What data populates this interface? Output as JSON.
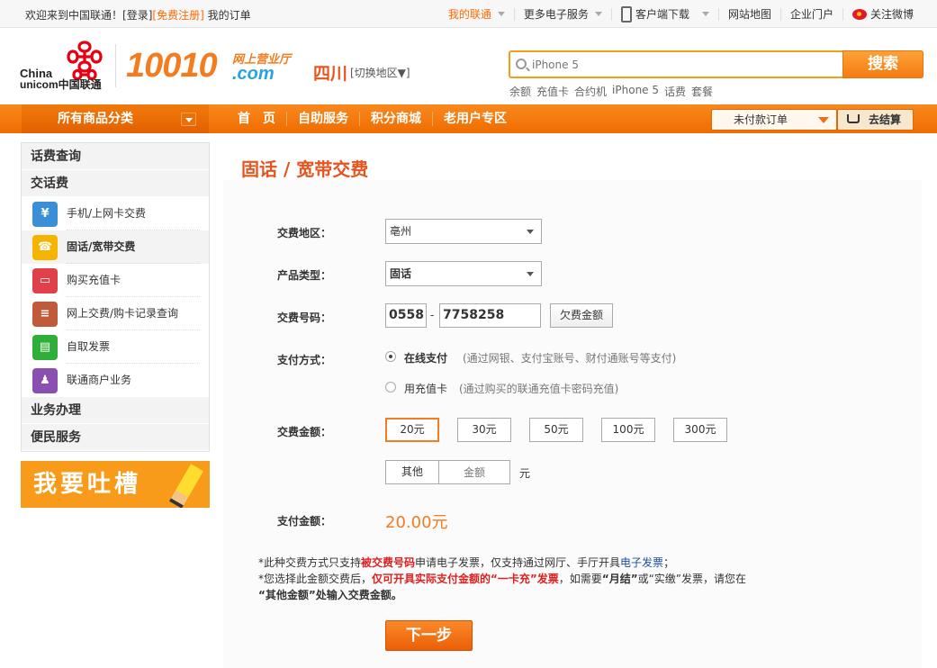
{
  "topbar": {
    "welcome": "欢迎来到中国联通！",
    "login": "[登录]",
    "register": "[免费注册]",
    "my_orders": "我的订单",
    "my_unicom": "我的联通",
    "more_services": "更多电子服务",
    "client_download": "客户端下载",
    "sitemap": "网站地图",
    "enterprise": "企业门户",
    "weibo": "关注微博"
  },
  "header": {
    "logo_cn": "China",
    "logo_unicom": "unicom中国联通",
    "logo_number": "10010",
    "logo_hall": "网上营业厅",
    "logo_com": ".com",
    "province": "四川",
    "switch_area": "[切换地区▼]",
    "search_placeholder": "iPhone 5",
    "search_button": "搜索",
    "hotwords": [
      "余额",
      "充值卡",
      "合约机",
      "iPhone 5",
      "话费",
      "套餐"
    ]
  },
  "nav": {
    "all_categories": "所有商品分类",
    "links": [
      "首　页",
      "自助服务",
      "积分商城",
      "老用户专区"
    ],
    "unpaid_orders": "未付款订单",
    "checkout": "去结算"
  },
  "sidebar": {
    "sections": {
      "bill_query": "话费查询",
      "pay_bill": "交话费",
      "business": "业务办理",
      "convenience": "便民服务"
    },
    "items": [
      {
        "label": "手机/上网卡交费",
        "icon": "mobile-icon",
        "color": "#3a8fd6"
      },
      {
        "label": "固话/宽带交费",
        "icon": "telephone-icon",
        "color": "#f5b400"
      },
      {
        "label": "购买充值卡",
        "icon": "card-icon",
        "color": "#e0404a"
      },
      {
        "label": "网上交费/购卡记录查询",
        "icon": "record-icon",
        "color": "#c05a3a"
      },
      {
        "label": "自取发票",
        "icon": "invoice-icon",
        "color": "#2fae3a"
      },
      {
        "label": "联通商户业务",
        "icon": "merchant-icon",
        "color": "#8a4fb0"
      }
    ],
    "banner": "我要吐槽"
  },
  "form": {
    "title": "固话 / 宽带交费",
    "area_label": "交费地区：",
    "area_value": "亳州",
    "product_label": "产品类型：",
    "product_value": "固话",
    "number_label": "交费号码：",
    "area_code": "0558",
    "dash": "-",
    "phone_number": "7758258",
    "arrears_button": "欠费金额",
    "pay_method_label": "支付方式：",
    "online_pay": "在线支付",
    "online_note": "(通过网银、支付宝账号、财付通账号等支付)",
    "card_pay": "用充值卡",
    "card_note": "(通过购买的联通充值卡密码充值)",
    "amount_label": "交费金额：",
    "amounts": [
      "20元",
      "30元",
      "50元",
      "100元",
      "300元"
    ],
    "other_button": "其他",
    "other_placeholder": "金额",
    "unit": "元",
    "paid_label": "支付金额：",
    "paid_value": "20.00元",
    "next_button": "下一步"
  },
  "notes": {
    "line1_a": "*此种交费方式只支持",
    "line1_b": "被交费号码",
    "line1_c": "申请电子发票，仅支持通过网厅、手厅开具",
    "line1_d": "电子发票",
    "line1_e": "；",
    "line2_a": "*您选择此金额交费后，",
    "line2_b": "仅可开具实际支付金额的“一卡充”发票",
    "line2_c": "，如需要",
    "line2_d": "“月结”",
    "line2_e": "或“实缴”发票，请您在",
    "line3_a": "“其他金额”处输入交费金额。"
  }
}
